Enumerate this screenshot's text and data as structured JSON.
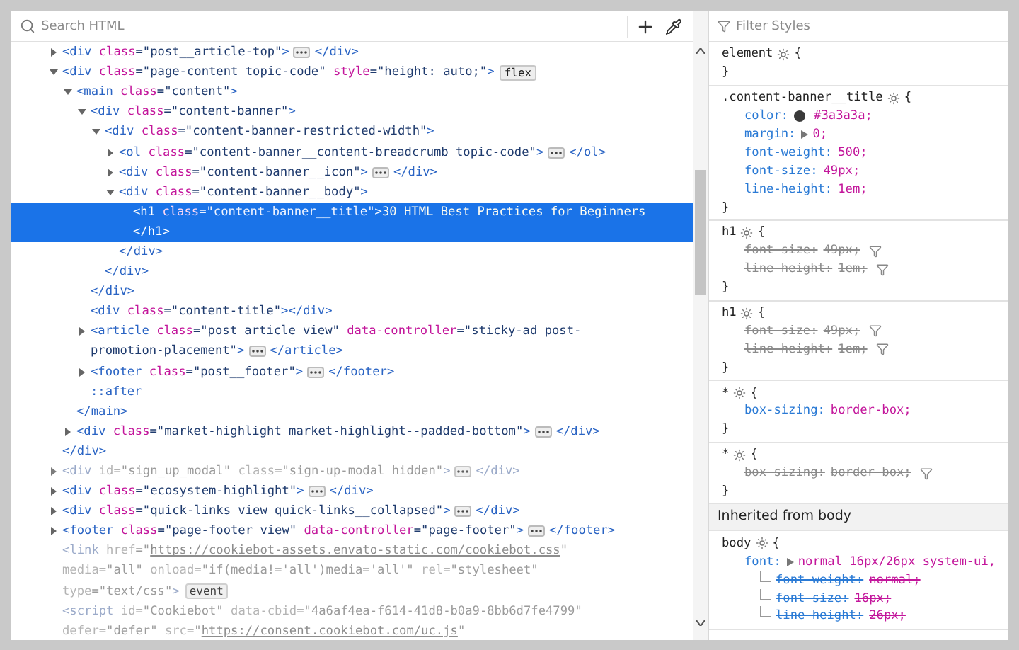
{
  "markup": {
    "search_placeholder": "Search HTML",
    "nodes": [
      {
        "expanded": false,
        "selected": false,
        "dimmed": false,
        "lines": [
          [
            {
              "kind": "tag",
              "text": "<div"
            },
            {
              "kind": "attr",
              "text": " class"
            },
            {
              "kind": "value",
              "text": "=\"post__article-top\""
            },
            {
              "kind": "tag",
              "text": ">"
            },
            {
              "kind": "more"
            },
            {
              "kind": "tag",
              "text": "</div>"
            }
          ]
        ]
      },
      {
        "expanded": true,
        "selected": false,
        "dimmed": false,
        "lines": [
          [
            {
              "kind": "tag",
              "text": "<div"
            },
            {
              "kind": "attr",
              "text": " class"
            },
            {
              "kind": "value",
              "text": "=\"page-content topic-code\""
            },
            {
              "kind": "attr",
              "text": " style"
            },
            {
              "kind": "value",
              "text": "=\"height: auto;\""
            },
            {
              "kind": "tag",
              "text": ">"
            },
            {
              "kind": "badge",
              "text": "flex"
            }
          ]
        ],
        "close": [
          {
            "kind": "tag",
            "text": "</div>"
          }
        ],
        "children": [
          {
            "expanded": true,
            "selected": false,
            "dimmed": false,
            "lines": [
              [
                {
                  "kind": "tag",
                  "text": "<main"
                },
                {
                  "kind": "attr",
                  "text": " class"
                },
                {
                  "kind": "value",
                  "text": "=\"content\""
                },
                {
                  "kind": "tag",
                  "text": ">"
                }
              ]
            ],
            "close": [
              {
                "kind": "tag",
                "text": "</main>"
              }
            ],
            "children": [
              {
                "expanded": true,
                "selected": false,
                "dimmed": false,
                "lines": [
                  [
                    {
                      "kind": "tag",
                      "text": "<div"
                    },
                    {
                      "kind": "attr",
                      "text": " class"
                    },
                    {
                      "kind": "value",
                      "text": "=\"content-banner\""
                    },
                    {
                      "kind": "tag",
                      "text": ">"
                    }
                  ]
                ],
                "close": [
                  {
                    "kind": "tag",
                    "text": "</div>"
                  }
                ],
                "children": [
                  {
                    "expanded": true,
                    "selected": false,
                    "dimmed": false,
                    "lines": [
                      [
                        {
                          "kind": "tag",
                          "text": "<div"
                        },
                        {
                          "kind": "attr",
                          "text": " class"
                        },
                        {
                          "kind": "value",
                          "text": "=\"content-banner-restricted-width\""
                        },
                        {
                          "kind": "tag",
                          "text": ">"
                        }
                      ]
                    ],
                    "close": [
                      {
                        "kind": "tag",
                        "text": "</div>"
                      }
                    ],
                    "children": [
                      {
                        "expanded": false,
                        "selected": false,
                        "dimmed": false,
                        "lines": [
                          [
                            {
                              "kind": "tag",
                              "text": "<ol"
                            },
                            {
                              "kind": "attr",
                              "text": " class"
                            },
                            {
                              "kind": "value",
                              "text": "=\"content-banner__content-breadcrumb topic-code\""
                            },
                            {
                              "kind": "tag",
                              "text": ">"
                            },
                            {
                              "kind": "more"
                            },
                            {
                              "kind": "tag",
                              "text": "</ol>"
                            }
                          ]
                        ]
                      },
                      {
                        "expanded": false,
                        "selected": false,
                        "dimmed": false,
                        "lines": [
                          [
                            {
                              "kind": "tag",
                              "text": "<div"
                            },
                            {
                              "kind": "attr",
                              "text": " class"
                            },
                            {
                              "kind": "value",
                              "text": "=\"content-banner__icon\""
                            },
                            {
                              "kind": "tag",
                              "text": ">"
                            },
                            {
                              "kind": "more"
                            },
                            {
                              "kind": "tag",
                              "text": "</div>"
                            }
                          ]
                        ]
                      },
                      {
                        "expanded": true,
                        "selected": false,
                        "dimmed": false,
                        "lines": [
                          [
                            {
                              "kind": "tag",
                              "text": "<div"
                            },
                            {
                              "kind": "attr",
                              "text": " class"
                            },
                            {
                              "kind": "value",
                              "text": "=\"content-banner__body\""
                            },
                            {
                              "kind": "tag",
                              "text": ">"
                            }
                          ]
                        ],
                        "close": [
                          {
                            "kind": "tag",
                            "text": "</div>"
                          }
                        ],
                        "children": [
                          {
                            "selected": true,
                            "dimmed": false,
                            "lines": [
                              [
                                {
                                  "kind": "tag",
                                  "text": "<h1"
                                },
                                {
                                  "kind": "attr",
                                  "text": " class"
                                },
                                {
                                  "kind": "value",
                                  "text": "=\"content-banner__title\""
                                },
                                {
                                  "kind": "tag",
                                  "text": ">"
                                },
                                {
                                  "kind": "text",
                                  "text": "30 HTML Best Practices for Beginners"
                                }
                              ],
                              [
                                {
                                  "kind": "tag",
                                  "text": "</h1>"
                                }
                              ]
                            ]
                          }
                        ]
                      }
                    ]
                  }
                ]
              },
              {
                "selected": false,
                "dimmed": false,
                "lines": [
                  [
                    {
                      "kind": "tag",
                      "text": "<div"
                    },
                    {
                      "kind": "attr",
                      "text": " class"
                    },
                    {
                      "kind": "value",
                      "text": "=\"content-title\""
                    },
                    {
                      "kind": "tag",
                      "text": "></div>"
                    }
                  ]
                ]
              },
              {
                "expanded": false,
                "selected": false,
                "dimmed": false,
                "lines": [
                  [
                    {
                      "kind": "tag",
                      "text": "<article"
                    },
                    {
                      "kind": "attr",
                      "text": " class"
                    },
                    {
                      "kind": "value",
                      "text": "=\"post article view\""
                    },
                    {
                      "kind": "attr",
                      "text": " data-controller"
                    },
                    {
                      "kind": "value",
                      "text": "=\"sticky-ad post-"
                    }
                  ],
                  [
                    {
                      "kind": "value",
                      "text": "promotion-placement\""
                    },
                    {
                      "kind": "tag",
                      "text": ">"
                    },
                    {
                      "kind": "more"
                    },
                    {
                      "kind": "tag",
                      "text": "</article>"
                    }
                  ]
                ]
              },
              {
                "expanded": false,
                "selected": false,
                "dimmed": false,
                "lines": [
                  [
                    {
                      "kind": "tag",
                      "text": "<footer"
                    },
                    {
                      "kind": "attr",
                      "text": " class"
                    },
                    {
                      "kind": "value",
                      "text": "=\"post__footer\""
                    },
                    {
                      "kind": "tag",
                      "text": ">"
                    },
                    {
                      "kind": "more"
                    },
                    {
                      "kind": "tag",
                      "text": "</footer>"
                    }
                  ]
                ]
              },
              {
                "selected": false,
                "dimmed": false,
                "lines": [
                  [
                    {
                      "kind": "pseudo",
                      "text": "::after"
                    }
                  ]
                ]
              }
            ]
          },
          {
            "expanded": false,
            "selected": false,
            "dimmed": false,
            "lines": [
              [
                {
                  "kind": "tag",
                  "text": "<div"
                },
                {
                  "kind": "attr",
                  "text": " class"
                },
                {
                  "kind": "value",
                  "text": "=\"market-highlight market-highlight--padded-bottom\""
                },
                {
                  "kind": "tag",
                  "text": ">"
                },
                {
                  "kind": "more"
                },
                {
                  "kind": "tag",
                  "text": "</div>"
                }
              ]
            ]
          }
        ]
      },
      {
        "expanded": false,
        "selected": false,
        "dimmed": true,
        "lines": [
          [
            {
              "kind": "tag",
              "text": "<div"
            },
            {
              "kind": "attr",
              "text": " id"
            },
            {
              "kind": "value",
              "text": "=\"sign_up_modal\""
            },
            {
              "kind": "attr",
              "text": " class"
            },
            {
              "kind": "value",
              "text": "=\"sign-up-modal hidden\""
            },
            {
              "kind": "tag",
              "text": ">"
            },
            {
              "kind": "more"
            },
            {
              "kind": "tag",
              "text": "</div>"
            }
          ]
        ]
      },
      {
        "expanded": false,
        "selected": false,
        "dimmed": false,
        "lines": [
          [
            {
              "kind": "tag",
              "text": "<div"
            },
            {
              "kind": "attr",
              "text": " class"
            },
            {
              "kind": "value",
              "text": "=\"ecosystem-highlight\""
            },
            {
              "kind": "tag",
              "text": ">"
            },
            {
              "kind": "more"
            },
            {
              "kind": "tag",
              "text": "</div>"
            }
          ]
        ]
      },
      {
        "expanded": false,
        "selected": false,
        "dimmed": false,
        "lines": [
          [
            {
              "kind": "tag",
              "text": "<div"
            },
            {
              "kind": "attr",
              "text": " class"
            },
            {
              "kind": "value",
              "text": "=\"quick-links view quick-links__collapsed\""
            },
            {
              "kind": "tag",
              "text": ">"
            },
            {
              "kind": "more"
            },
            {
              "kind": "tag",
              "text": "</div>"
            }
          ]
        ]
      },
      {
        "expanded": false,
        "selected": false,
        "dimmed": false,
        "lines": [
          [
            {
              "kind": "tag",
              "text": "<footer"
            },
            {
              "kind": "attr",
              "text": " class"
            },
            {
              "kind": "value",
              "text": "=\"page-footer view\""
            },
            {
              "kind": "attr",
              "text": " data-controller"
            },
            {
              "kind": "value",
              "text": "=\"page-footer\""
            },
            {
              "kind": "tag",
              "text": ">"
            },
            {
              "kind": "more"
            },
            {
              "kind": "tag",
              "text": "</footer>"
            }
          ]
        ]
      },
      {
        "selected": false,
        "dimmed": true,
        "lines": [
          [
            {
              "kind": "tag",
              "text": "<link"
            },
            {
              "kind": "attr",
              "text": " href"
            },
            {
              "kind": "value",
              "text": "=\""
            },
            {
              "kind": "link",
              "text": "https://cookiebot-assets.envato-static.com/cookiebot.css"
            },
            {
              "kind": "value",
              "text": "\""
            }
          ],
          [
            {
              "kind": "attr",
              "text": "media"
            },
            {
              "kind": "value",
              "text": "=\"all\""
            },
            {
              "kind": "attr",
              "text": " onload"
            },
            {
              "kind": "value",
              "text": "=\"if(media!='all')media='all'\""
            },
            {
              "kind": "attr",
              "text": " rel"
            },
            {
              "kind": "value",
              "text": "=\"stylesheet\""
            }
          ],
          [
            {
              "kind": "attr",
              "text": "type"
            },
            {
              "kind": "value",
              "text": "=\"text/css\""
            },
            {
              "kind": "tag",
              "text": ">"
            },
            {
              "kind": "badge",
              "text": "event"
            }
          ]
        ]
      },
      {
        "selected": false,
        "dimmed": true,
        "lines": [
          [
            {
              "kind": "tag",
              "text": "<script"
            },
            {
              "kind": "attr",
              "text": " id"
            },
            {
              "kind": "value",
              "text": "=\"Cookiebot\""
            },
            {
              "kind": "attr",
              "text": " data-cbid"
            },
            {
              "kind": "value",
              "text": "=\"4a6af4ea-f614-41d8-b0a9-8bb6d7fe4799\""
            }
          ],
          [
            {
              "kind": "attr",
              "text": "defer"
            },
            {
              "kind": "value",
              "text": "=\"defer\""
            },
            {
              "kind": "attr",
              "text": " src"
            },
            {
              "kind": "value",
              "text": "=\""
            },
            {
              "kind": "link",
              "text": "https://consent.cookiebot.com/uc.js"
            },
            {
              "kind": "value",
              "text": "\""
            }
          ]
        ]
      }
    ]
  },
  "styles": {
    "filter_placeholder": "Filter Styles",
    "rules": [
      {
        "selector": "element",
        "open": "{",
        "close": "}"
      },
      {
        "selector": ".content-banner__title",
        "open": "{",
        "close": "}",
        "properties": [
          {
            "name": "color:",
            "value": "#3a3a3a;",
            "color": "#3a3a3a",
            "overridden": false
          },
          {
            "name": "margin:",
            "value": "0;",
            "expander": true,
            "overridden": false
          },
          {
            "name": "font-weight:",
            "value": "500;",
            "overridden": false
          },
          {
            "name": "font-size:",
            "value": "49px;",
            "overridden": false
          },
          {
            "name": "line-height:",
            "value": "1em;",
            "overridden": false
          }
        ]
      },
      {
        "selector": "h1",
        "open": "{",
        "close": "}",
        "properties": [
          {
            "name": "font-size:",
            "value": "49px;",
            "overridden": true
          },
          {
            "name": "line-height:",
            "value": "1em;",
            "overridden": true
          }
        ]
      },
      {
        "selector": "h1",
        "open": "{",
        "close": "}",
        "properties": [
          {
            "name": "font-size:",
            "value": "49px;",
            "overridden": true
          },
          {
            "name": "line-height:",
            "value": "1em;",
            "overridden": true
          }
        ]
      },
      {
        "selector": "*",
        "open": "{",
        "close": "}",
        "properties": [
          {
            "name": "box-sizing:",
            "value": "border-box;",
            "overridden": false
          }
        ]
      },
      {
        "selector": "*",
        "open": "{",
        "close": "}",
        "properties": [
          {
            "name": "box-sizing:",
            "value": "border-box;",
            "overridden": true
          }
        ]
      }
    ],
    "inherited_header": "Inherited from body",
    "inherited_rules": [
      {
        "selector": "body",
        "open": "{",
        "properties": [
          {
            "name": "font:",
            "value": "normal 16px/26px system-ui,",
            "expander": true,
            "overridden": false,
            "children": [
              {
                "name": "font-weight:",
                "value": "normal;",
                "overridden": true
              },
              {
                "name": "font-size:",
                "value": "16px;",
                "overridden": true
              },
              {
                "name": "line-height:",
                "value": "26px;",
                "overridden": true
              }
            ]
          }
        ]
      }
    ]
  }
}
